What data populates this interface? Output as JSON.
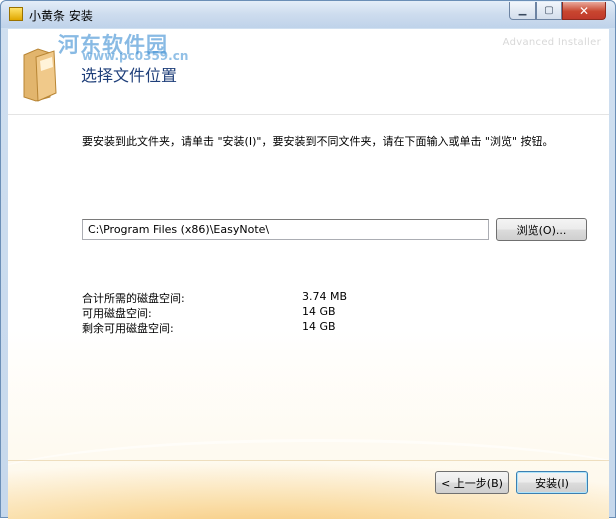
{
  "window": {
    "title": "小黄条 安装",
    "brand_text": "Advanced Installer",
    "watermark_site": "河东软件园",
    "watermark_url": "www.pc0359.cn"
  },
  "page": {
    "title": "选择文件位置",
    "instruction": "要安装到此文件夹，请单击 \"安装(I)\"，要安装到不同文件夹，请在下面输入或单击 \"浏览\" 按钮。"
  },
  "path_field": {
    "value": "C:\\Program Files (x86)\\EasyNote\\"
  },
  "buttons": {
    "browse": "浏览(O)...",
    "back": "< 上一步(B)",
    "install": "安装(I)"
  },
  "disk_space": [
    {
      "label": "合计所需的磁盘空间:",
      "value": "3.74 MB"
    },
    {
      "label": "可用磁盘空间:",
      "value": "14 GB"
    },
    {
      "label": "剩余可用磁盘空间:",
      "value": "14 GB"
    }
  ],
  "icons": {
    "app": "app-icon",
    "minimize": "minimize-icon",
    "maximize": "maximize-icon",
    "close": "close-icon",
    "folder": "folder-icon"
  },
  "colors": {
    "title_blue": "#1f3f7a",
    "close_red": "#c0392b",
    "accent_orange": "#f3b24a"
  }
}
